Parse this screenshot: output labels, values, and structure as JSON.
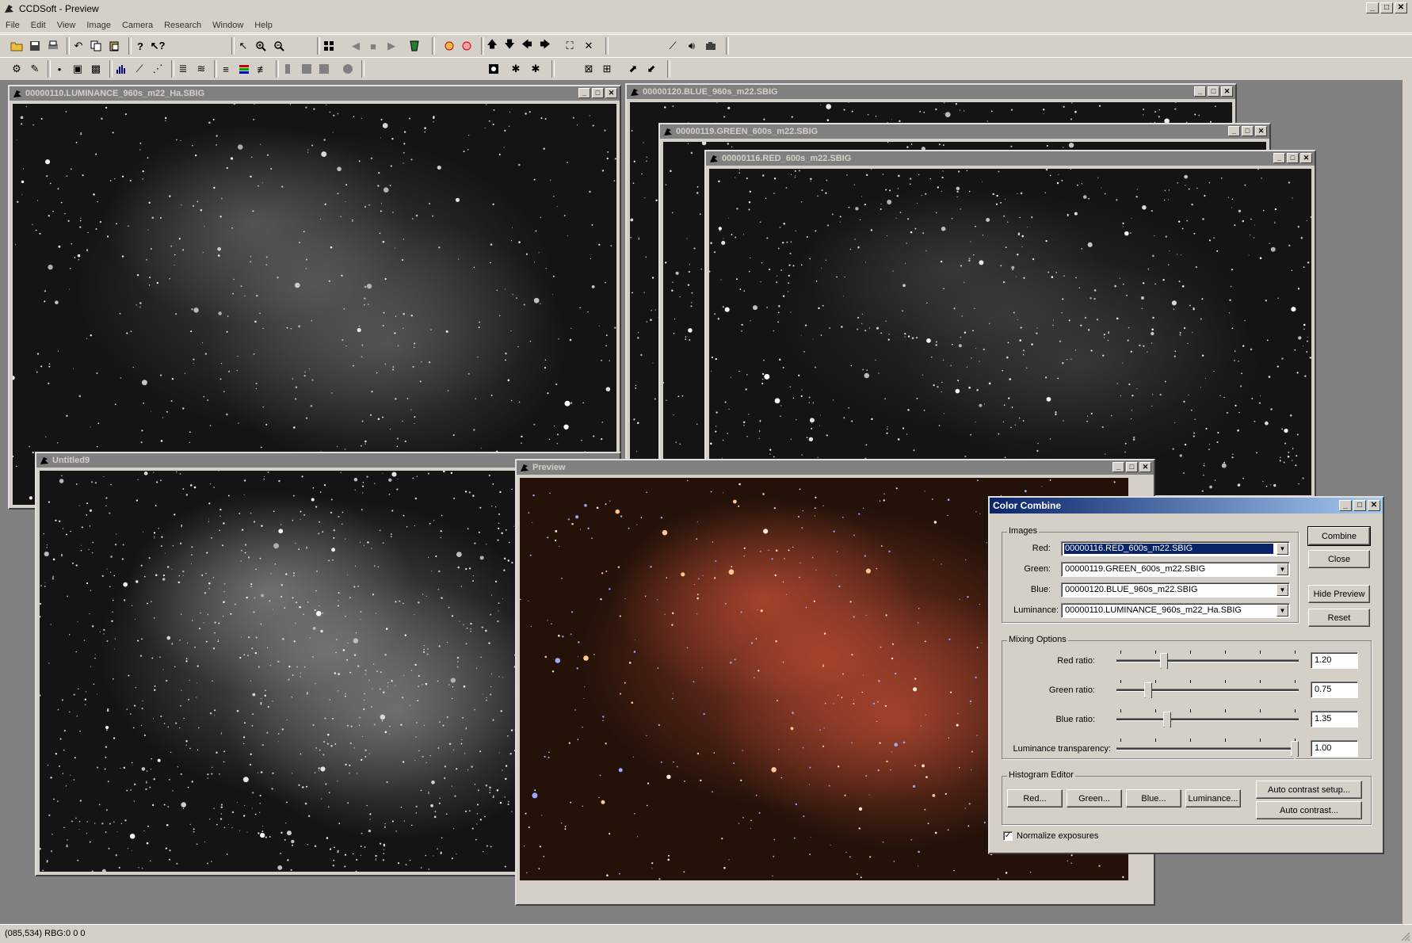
{
  "app": {
    "title": "CCDSoft  - Preview",
    "window_buttons": {
      "minimize": "_",
      "maximize": "□",
      "close": "✕"
    }
  },
  "menu": [
    "File",
    "Edit",
    "View",
    "Image",
    "Camera",
    "Research",
    "Window",
    "Help"
  ],
  "windows": {
    "luminance": {
      "title": "00000110.LUMINANCE_960s_m22_Ha.SBIG"
    },
    "blue": {
      "title": "00000120.BLUE_960s_m22.SBIG"
    },
    "green": {
      "title": "00000119.GREEN_600s_m22.SBIG"
    },
    "red": {
      "title": "00000116.RED_600s_m22.SBIG"
    },
    "untitled": {
      "title": "Untitled9"
    },
    "preview": {
      "title": "Preview"
    }
  },
  "dialog": {
    "title": "Color Combine",
    "images_group": "Images",
    "red_label": "Red:",
    "red_value": "00000116.RED_600s_m22.SBIG",
    "green_label": "Green:",
    "green_value": "00000119.GREEN_600s_m22.SBIG",
    "blue_label": "Blue:",
    "blue_value": "00000120.BLUE_960s_m22.SBIG",
    "lum_label": "Luminance:",
    "lum_value": "00000110.LUMINANCE_960s_m22_Ha.SBIG",
    "combine": "Combine",
    "close": "Close",
    "hide_preview": "Hide Preview",
    "reset": "Reset",
    "mixing_group": "Mixing Options",
    "red_ratio_label": "Red ratio:",
    "red_ratio": "1.20",
    "green_ratio_label": "Green ratio:",
    "green_ratio": "0.75",
    "blue_ratio_label": "Blue ratio:",
    "blue_ratio": "1.35",
    "lum_trans_label": "Luminance transparency:",
    "lum_trans": "1.00",
    "slider_levels": {
      "red": 0.25,
      "green": 0.16,
      "blue": 0.27,
      "luminance": 1.0
    },
    "histogram_group": "Histogram Editor",
    "hist_red": "Red...",
    "hist_green": "Green...",
    "hist_blue": "Blue...",
    "hist_lum": "Luminance...",
    "auto_contrast_setup": "Auto contrast setup...",
    "auto_contrast": "Auto contrast...",
    "normalize_label": "Normalize exposures",
    "normalize_checked": true
  },
  "status": {
    "text": "(085,534) RBG:0 0 0"
  }
}
